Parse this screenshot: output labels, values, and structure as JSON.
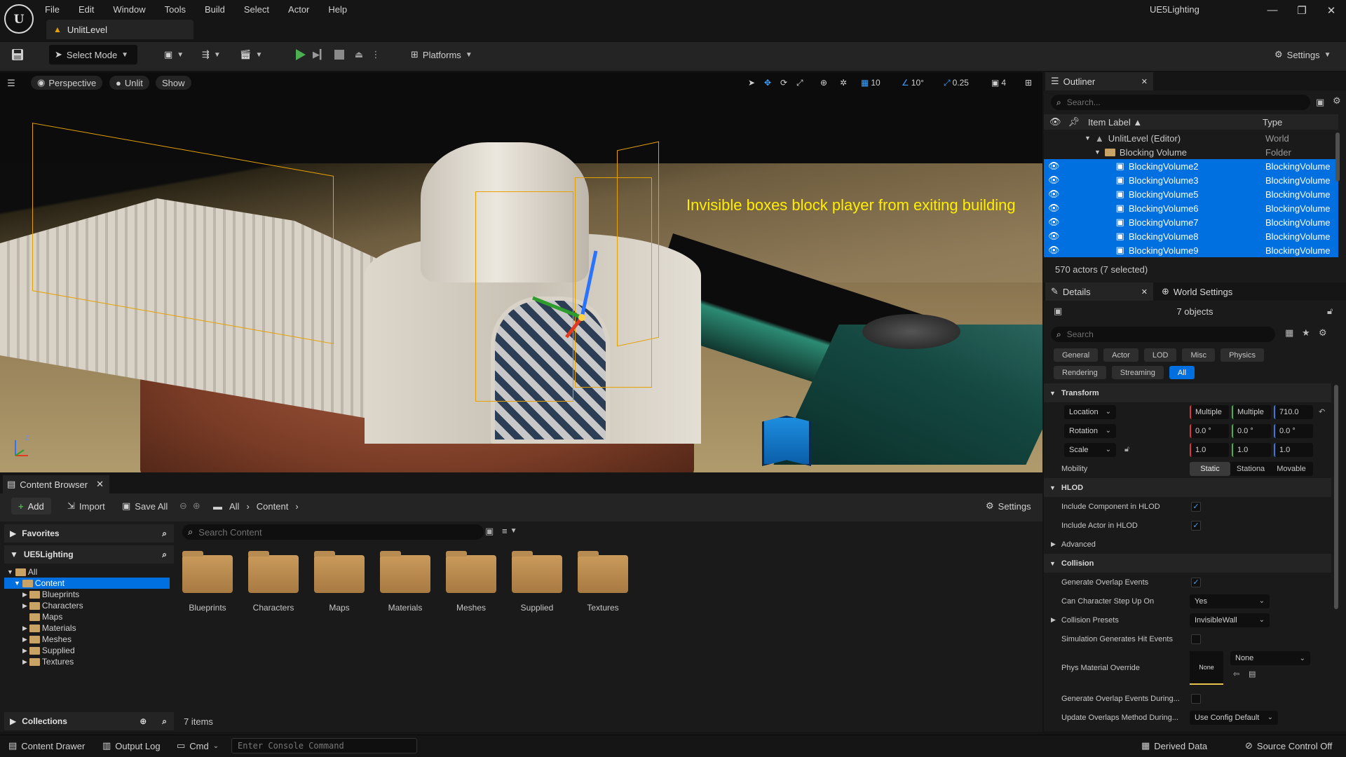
{
  "menu": [
    "File",
    "Edit",
    "Window",
    "Tools",
    "Build",
    "Select",
    "Actor",
    "Help"
  ],
  "project_title": "UE5Lighting",
  "level_tab": "UnlitLevel",
  "toolbar": {
    "select_mode": "Select Mode",
    "platforms": "Platforms",
    "settings": "Settings"
  },
  "viewport": {
    "perspective": "Perspective",
    "unlit": "Unlit",
    "show": "Show",
    "grid_snap": "10",
    "angle_snap": "10°",
    "scale_snap": "0.25",
    "camera_speed": "4",
    "annotation": "Invisible boxes block player from exiting building"
  },
  "content_browser": {
    "tab": "Content Browser",
    "add": "Add",
    "import": "Import",
    "save_all": "Save All",
    "path_all": "All",
    "path_content": "Content",
    "settings": "Settings",
    "favorites": "Favorites",
    "project": "UE5Lighting",
    "collections": "Collections",
    "search_placeholder": "Search Content",
    "tree": [
      "All",
      "Content",
      "Blueprints",
      "Characters",
      "Maps",
      "Materials",
      "Meshes",
      "Supplied",
      "Textures"
    ],
    "assets": [
      "Blueprints",
      "Characters",
      "Maps",
      "Materials",
      "Meshes",
      "Supplied",
      "Textures"
    ],
    "item_count": "7 items"
  },
  "outliner": {
    "tab": "Outliner",
    "search_placeholder": "Search...",
    "col_label": "Item Label ▲",
    "col_type": "Type",
    "rows": [
      {
        "label": "UnlitLevel (Editor)",
        "type": "World"
      },
      {
        "label": "Blocking Volume",
        "type": "Folder"
      },
      {
        "label": "BlockingVolume2",
        "type": "BlockingVolume"
      },
      {
        "label": "BlockingVolume3",
        "type": "BlockingVolume"
      },
      {
        "label": "BlockingVolume5",
        "type": "BlockingVolume"
      },
      {
        "label": "BlockingVolume6",
        "type": "BlockingVolume"
      },
      {
        "label": "BlockingVolume7",
        "type": "BlockingVolume"
      },
      {
        "label": "BlockingVolume8",
        "type": "BlockingVolume"
      },
      {
        "label": "BlockingVolume9",
        "type": "BlockingVolume"
      }
    ],
    "status": "570 actors (7 selected)"
  },
  "details": {
    "tab": "Details",
    "world_settings_tab": "World Settings",
    "objects": "7 objects",
    "search_placeholder": "Search",
    "filters_row1": [
      "General",
      "Actor",
      "LOD",
      "Misc",
      "Physics"
    ],
    "filters_row2": [
      "Rendering",
      "Streaming",
      "All"
    ],
    "transform": "Transform",
    "location": "Location",
    "location_values": [
      "Multiple",
      "Multiple",
      "710.0"
    ],
    "rotation": "Rotation",
    "rotation_values": [
      "0.0 °",
      "0.0 °",
      "0.0 °"
    ],
    "scale": "Scale",
    "scale_values": [
      "1.0",
      "1.0",
      "1.0"
    ],
    "mobility": "Mobility",
    "mobility_options": [
      "Static",
      "Stationa",
      "Movable"
    ],
    "hlod": "HLOD",
    "include_component": "Include Component in HLOD",
    "include_actor": "Include Actor in HLOD",
    "advanced": "Advanced",
    "collision": "Collision",
    "generate_overlap": "Generate Overlap Events",
    "can_step_up": "Can Character Step Up On",
    "can_step_up_value": "Yes",
    "collision_presets": "Collision Presets",
    "collision_presets_value": "InvisibleWall",
    "sim_hit_events": "Simulation Generates Hit Events",
    "phys_material": "Phys Material Override",
    "phys_thumb": "None",
    "phys_value": "None",
    "gen_overlap_during": "Generate Overlap Events During...",
    "update_overlaps": "Update Overlaps Method During...",
    "update_overlaps_value": "Use Config Default"
  },
  "statusbar": {
    "content_drawer": "Content Drawer",
    "output_log": "Output Log",
    "cmd": "Cmd",
    "console_placeholder": "Enter Console Command",
    "derived_data": "Derived Data",
    "source_control": "Source Control Off"
  },
  "colors": {
    "selection": "#0070e0",
    "annotation": "#ffee00",
    "bounds": "#e6a000",
    "play": "#4caf50"
  }
}
